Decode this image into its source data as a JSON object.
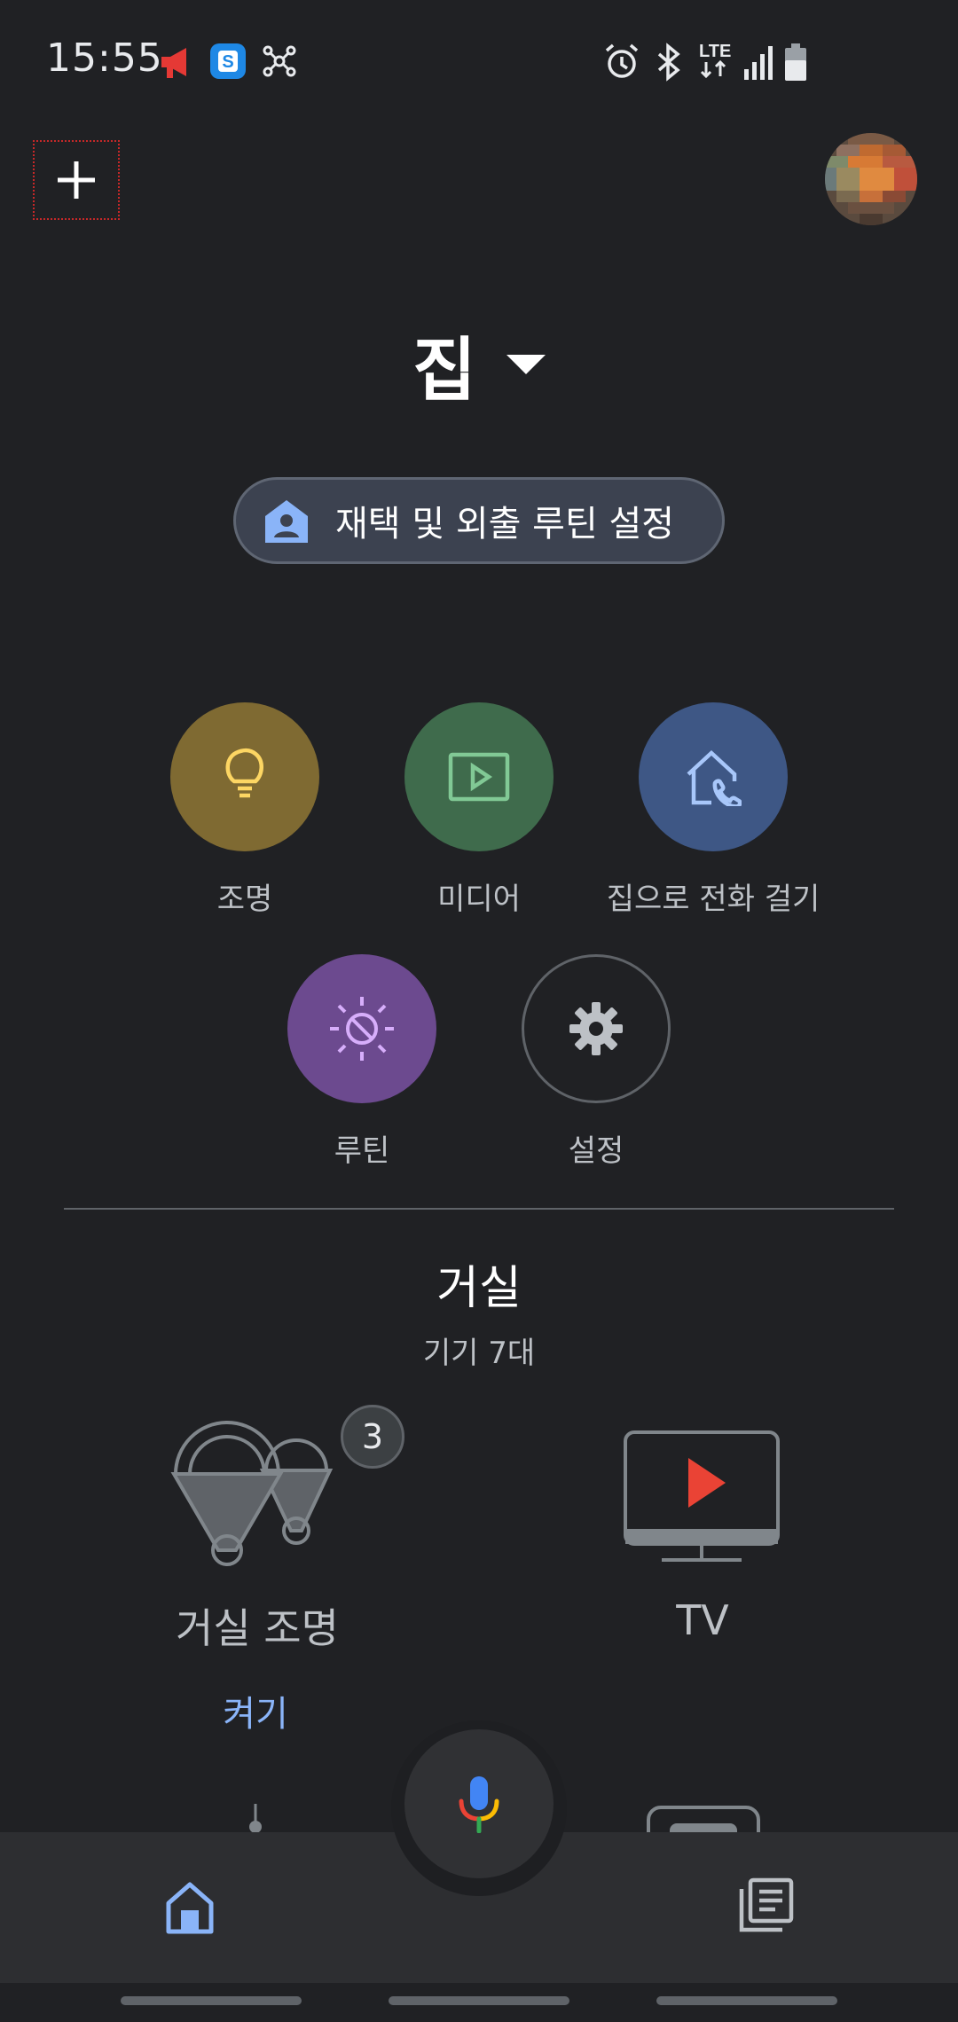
{
  "status_bar": {
    "time": "15:55",
    "network": "LTE"
  },
  "home": {
    "title": "집",
    "routine_chip_label": "재택 및 외출 루틴 설정"
  },
  "actions": [
    {
      "label": "조명",
      "icon": "lightbulb-icon",
      "color": "#7f6a32"
    },
    {
      "label": "미디어",
      "icon": "media-play-icon",
      "color": "#3f6b4c"
    },
    {
      "label": "집으로 전화 걸기",
      "icon": "call-home-icon",
      "color": "#3e5785"
    },
    {
      "label": "루틴",
      "icon": "routine-sun-icon",
      "color": "#6c4a8f"
    },
    {
      "label": "설정",
      "icon": "gear-icon",
      "color": "#202124"
    }
  ],
  "room": {
    "name": "거실",
    "device_count": "기기 7대",
    "devices": [
      {
        "name": "거실 조명",
        "badge": "3",
        "action": "켜기",
        "icon": "light-group-icon"
      },
      {
        "name": "TV",
        "icon": "tv-icon"
      }
    ]
  },
  "colors": {
    "background": "#202124",
    "accent_blue": "#8ab4f8",
    "nav_background": "#2d2e31"
  }
}
